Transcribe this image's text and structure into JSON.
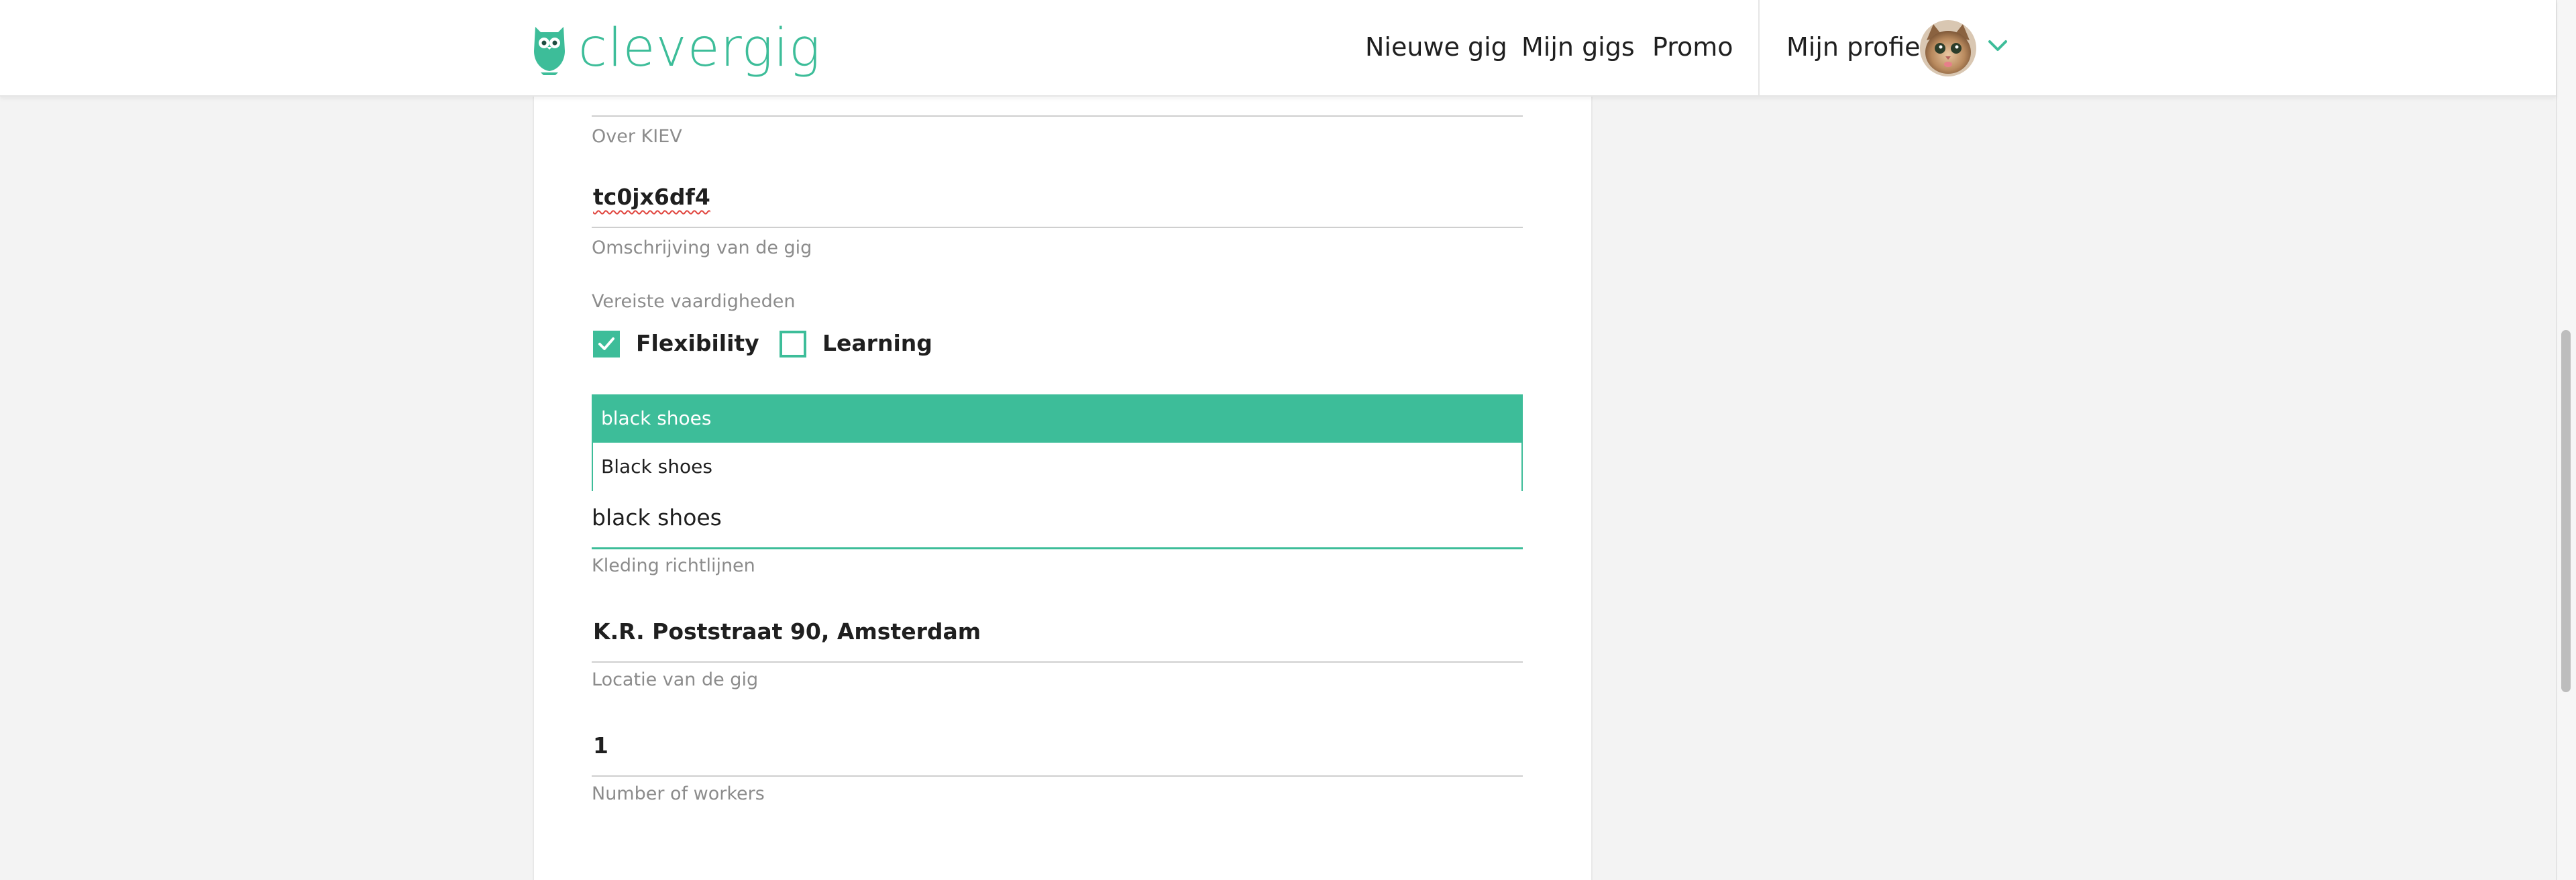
{
  "header": {
    "logo_text": "clevergig",
    "nav": {
      "new_gig": "Nieuwe gig",
      "my_gigs": "Mijn gigs",
      "promo": "Promo",
      "profile": "Mijn profiel"
    }
  },
  "colors": {
    "accent": "#3dbd99",
    "background": "#f3f3f3",
    "card": "#ffffff",
    "helper_text": "#8c8c8c"
  },
  "form": {
    "about_company": {
      "helper": "Over KIEV"
    },
    "gig_description": {
      "value": "tc0jx6df4",
      "helper": "Omschrijving van de gig"
    },
    "required_skills": {
      "label": "Vereiste vaardigheden",
      "options": [
        {
          "label": "Flexibility",
          "checked": true
        },
        {
          "label": "Learning",
          "checked": false
        }
      ]
    },
    "dress_code": {
      "suggestions": [
        "black shoes",
        "Black shoes"
      ],
      "value": "black shoes",
      "helper": "Kleding richtlijnen"
    },
    "location": {
      "value": "K.R. Poststraat 90, Amsterdam",
      "helper": "Locatie van de gig"
    },
    "workers": {
      "value": "1",
      "helper": "Number of workers"
    }
  }
}
